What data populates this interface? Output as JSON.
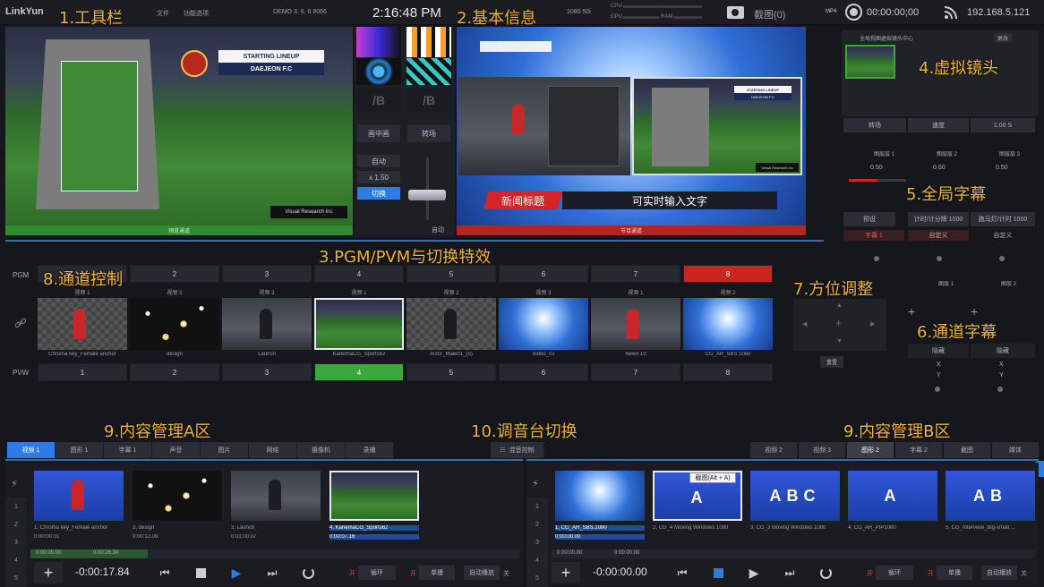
{
  "toolbar": {
    "app_name": "LinkYun",
    "menu_file": "文件",
    "menu_mode": "功能选项",
    "demo_info": "DEMO 3. 6. 6 8066",
    "clock": "2:16:48 PM",
    "format": "1080 50i",
    "cpu_label": "CPU",
    "gpu_label": "GPU",
    "ram_label": "RAM",
    "screenshot_label": "截图(0)",
    "mp4_label": "MP4",
    "record_time": "00:00:00;00",
    "ip_address": "192.168.5.121"
  },
  "annotations": {
    "a1": "1.工具栏",
    "a2": "2.基本信息",
    "a3": "3.PGM/PVM与切换特效",
    "a4": "4.虚拟镜头",
    "a5": "5.全局字幕",
    "a6": "6.通道字幕",
    "a7": "7.方位调整",
    "a8": "8.通道控制",
    "a9a": "9.内容管理A区",
    "a9b": "9.内容管理B区",
    "a10": "10.调音台切换"
  },
  "pvw_monitor": {
    "label": "预览通道",
    "lineup_title": "STARTING LINEUP",
    "lineup_team": "DAEJEON F.C",
    "logo_text": "Visual Research Inc"
  },
  "pgm_monitor": {
    "label": "节目通道",
    "lower_third_tag": "新闻标题",
    "lower_third_text": "可实时输入文字",
    "lineup_title": "STARTING LINEUP",
    "lineup_team": "DAEJEON F.C",
    "logo_text": "Visual Research Inc"
  },
  "transition": {
    "fx_a": "/B",
    "fx_b": "/B",
    "wipe_label": "画中画",
    "switch_label": "转场",
    "auto_label": "自动",
    "speed": "x 1.50",
    "cut_label": "切换",
    "auto2_label": "自动"
  },
  "virtual_camera": {
    "title": "全局视图虚拟镜头中心",
    "badge": "更改",
    "transition_label": "转场",
    "speed_label": "速度",
    "speed_value": "1.00 S",
    "layer1": "图层层 1",
    "layer2": "图层层 2",
    "layer3": "图层层 3",
    "v1": "0.50",
    "v2": "0.60",
    "v3": "0.50"
  },
  "global_subtitle": {
    "type_label": "预设",
    "opt1": "计时/计分牌 1000",
    "opt2": "跑马灯/计时 1000",
    "sub1": "字幕 1",
    "sub2": "自定义",
    "sub3": "自定义"
  },
  "channel_subtitle": {
    "layer1": "图层 1",
    "layer2": "图层 2",
    "btn1": "隐藏",
    "btn2": "隐藏",
    "x": "X",
    "y": "Y",
    "direction_btn": "重置"
  },
  "channels": {
    "pgm_label": "PGM",
    "pvw_label": "PVW",
    "pgm_buttons": [
      "1",
      "2",
      "3",
      "4",
      "5",
      "6",
      "7",
      "8"
    ],
    "pvw_buttons": [
      "1",
      "2",
      "3",
      "4",
      "5",
      "6",
      "7",
      "8"
    ],
    "sources": [
      {
        "top": "视频 1",
        "name": "Chroma key_Female anchor"
      },
      {
        "top": "视频 3",
        "name": "design"
      },
      {
        "top": "视频 3",
        "name": "Launch"
      },
      {
        "top": "视频 1",
        "name": "KariemaCG_Sports62"
      },
      {
        "top": "视频 2",
        "name": "Actor_Male01_(5)"
      },
      {
        "top": "视频 3",
        "name": "Video_01"
      },
      {
        "top": "视频 1",
        "name": "News 10"
      },
      {
        "top": "视频 2",
        "name": "CG_AR_SBS 1080"
      }
    ]
  },
  "tabs_a": [
    "视频 1",
    "图形 1",
    "字幕 1",
    "声音",
    "图片",
    "网络",
    "摄像机",
    "录播"
  ],
  "tabs_b": [
    "视频 2",
    "视频 3",
    "图形 2",
    "字幕 2",
    "截图",
    "媒体"
  ],
  "mixer_tab": "混音控制",
  "media_a": [
    {
      "name": "1, Chroma key_Female anchor",
      "time": "0:00:00.01"
    },
    {
      "name": "2, design",
      "time": "0:00:12.09"
    },
    {
      "name": "3, Launch",
      "time": "0:01:00.07"
    },
    {
      "name": "4, KariemaCG_Sports62",
      "time": "0:00:07.16"
    }
  ],
  "media_b": [
    {
      "name": "1, CG_AR_SBS.1080",
      "time": "0:00:00.00"
    },
    {
      "name": "2, CG_4 Moving Windows.1080",
      "time": ""
    },
    {
      "name": "3, CG_3 Moving Windows.1080",
      "time": ""
    },
    {
      "name": "4, CG_AR_PIP1080",
      "time": ""
    },
    {
      "name": "5, CG_Interview_Big-small ...",
      "time": ""
    }
  ],
  "tooltip": "截图(Alt + A)",
  "row_numbers": [
    "1",
    "2",
    "3",
    "4",
    "5"
  ],
  "transport_a": {
    "time": "-0:00:17.84",
    "progress_start": "0:00:00.00",
    "progress_end": "0:00:26.38",
    "loop_tag": "开",
    "loop_label": "循环",
    "single_tag": "开",
    "single_label": "单播",
    "auto_label": "自动播放",
    "auto_state": "关"
  },
  "transport_b": {
    "time": "-0:00:00.00",
    "progress_start": "0:00:00.00",
    "progress_end": "0:00:00.00",
    "loop_tag": "开",
    "loop_label": "循环",
    "single_tag": "开",
    "single_label": "单播",
    "auto_label": "自动播放",
    "auto_state": "关"
  },
  "colors": {
    "annotation": "#f2b531",
    "pgm_active": "#c8261e",
    "pvw_active": "#3aa83a",
    "accent_blue": "#2e7be8"
  }
}
